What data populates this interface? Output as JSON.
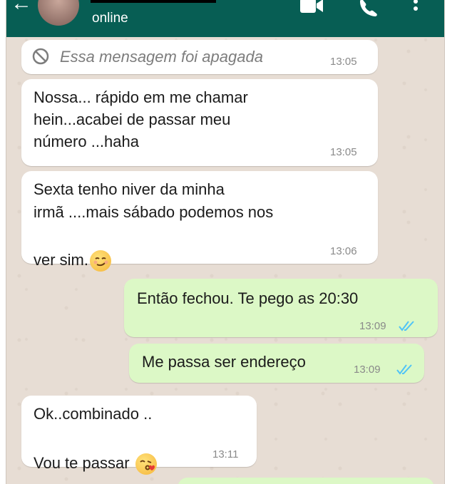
{
  "header": {
    "status": "online",
    "colors": {
      "bar": "#075e54",
      "outgoing": "#dcf8c6",
      "incoming": "#ffffff",
      "tick": "#4fc3f7"
    }
  },
  "messages": [
    {
      "direction": "in",
      "text": "Essa mensagem foi apagada",
      "time": "13:05",
      "deleted": true
    },
    {
      "direction": "in",
      "text": "Nossa... rápido em me chamar\nhein...acabei de passar meu\nnúmero ...haha",
      "time": "13:05"
    },
    {
      "direction": "in",
      "line1": "Sexta tenho niver da minha",
      "line2": "irmã ....mais sábado podemos nos",
      "line3": "ver sim.",
      "emoji": "smirk-face",
      "time": "13:06"
    },
    {
      "direction": "out",
      "text": "Então fechou. Te pego as 20:30",
      "time": "13:09",
      "status": "read"
    },
    {
      "direction": "out",
      "text": "Me passa ser endereço",
      "time": "13:09",
      "status": "read"
    },
    {
      "direction": "in",
      "line1": "Ok..combinado ..",
      "line2": "Vou te passar",
      "emoji": "kiss-face",
      "time": "13:11"
    }
  ]
}
